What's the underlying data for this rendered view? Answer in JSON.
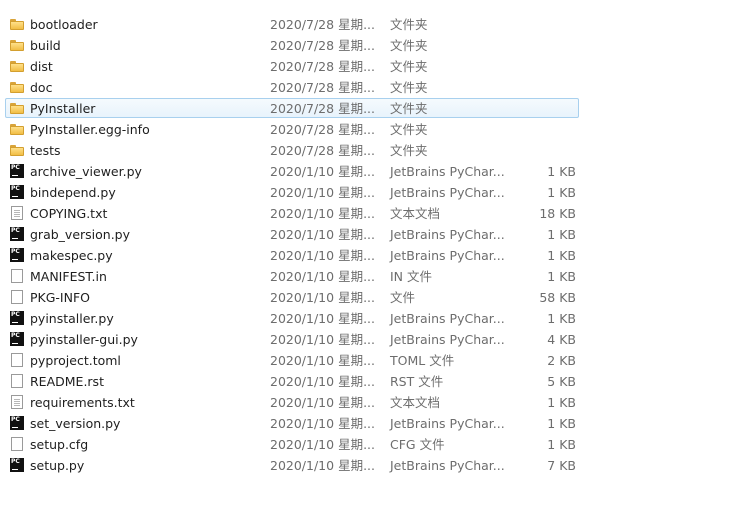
{
  "files": [
    {
      "name": "bootloader",
      "date": "2020/7/28 星期...",
      "type": "文件夹",
      "size": "",
      "icon": "folder-icon"
    },
    {
      "name": "build",
      "date": "2020/7/28 星期...",
      "type": "文件夹",
      "size": "",
      "icon": "folder-icon"
    },
    {
      "name": "dist",
      "date": "2020/7/28 星期...",
      "type": "文件夹",
      "size": "",
      "icon": "folder-icon"
    },
    {
      "name": "doc",
      "date": "2020/7/28 星期...",
      "type": "文件夹",
      "size": "",
      "icon": "folder-icon"
    },
    {
      "name": "PyInstaller",
      "date": "2020/7/28 星期...",
      "type": "文件夹",
      "size": "",
      "icon": "folder-icon",
      "selected": true
    },
    {
      "name": "PyInstaller.egg-info",
      "date": "2020/7/28 星期...",
      "type": "文件夹",
      "size": "",
      "icon": "folder-icon"
    },
    {
      "name": "tests",
      "date": "2020/7/28 星期...",
      "type": "文件夹",
      "size": "",
      "icon": "folder-icon"
    },
    {
      "name": "archive_viewer.py",
      "date": "2020/1/10 星期...",
      "type": "JetBrains PyChar...",
      "size": "1 KB",
      "icon": "pycharm-file-icon"
    },
    {
      "name": "bindepend.py",
      "date": "2020/1/10 星期...",
      "type": "JetBrains PyChar...",
      "size": "1 KB",
      "icon": "pycharm-file-icon"
    },
    {
      "name": "COPYING.txt",
      "date": "2020/1/10 星期...",
      "type": "文本文档",
      "size": "18 KB",
      "icon": "text-document-icon"
    },
    {
      "name": "grab_version.py",
      "date": "2020/1/10 星期...",
      "type": "JetBrains PyChar...",
      "size": "1 KB",
      "icon": "pycharm-file-icon"
    },
    {
      "name": "makespec.py",
      "date": "2020/1/10 星期...",
      "type": "JetBrains PyChar...",
      "size": "1 KB",
      "icon": "pycharm-file-icon"
    },
    {
      "name": "MANIFEST.in",
      "date": "2020/1/10 星期...",
      "type": "IN 文件",
      "size": "1 KB",
      "icon": "blank-file-icon"
    },
    {
      "name": "PKG-INFO",
      "date": "2020/1/10 星期...",
      "type": "文件",
      "size": "58 KB",
      "icon": "blank-file-icon"
    },
    {
      "name": "pyinstaller.py",
      "date": "2020/1/10 星期...",
      "type": "JetBrains PyChar...",
      "size": "1 KB",
      "icon": "pycharm-file-icon"
    },
    {
      "name": "pyinstaller-gui.py",
      "date": "2020/1/10 星期...",
      "type": "JetBrains PyChar...",
      "size": "4 KB",
      "icon": "pycharm-file-icon"
    },
    {
      "name": "pyproject.toml",
      "date": "2020/1/10 星期...",
      "type": "TOML 文件",
      "size": "2 KB",
      "icon": "blank-file-icon"
    },
    {
      "name": "README.rst",
      "date": "2020/1/10 星期...",
      "type": "RST 文件",
      "size": "5 KB",
      "icon": "blank-file-icon"
    },
    {
      "name": "requirements.txt",
      "date": "2020/1/10 星期...",
      "type": "文本文档",
      "size": "1 KB",
      "icon": "text-document-icon"
    },
    {
      "name": "set_version.py",
      "date": "2020/1/10 星期...",
      "type": "JetBrains PyChar...",
      "size": "1 KB",
      "icon": "pycharm-file-icon"
    },
    {
      "name": "setup.cfg",
      "date": "2020/1/10 星期...",
      "type": "CFG 文件",
      "size": "1 KB",
      "icon": "blank-file-icon"
    },
    {
      "name": "setup.py",
      "date": "2020/1/10 星期...",
      "type": "JetBrains PyChar...",
      "size": "7 KB",
      "icon": "pycharm-file-icon"
    }
  ],
  "colors": {
    "selection_border": "#a8d0ee",
    "selection_fill": "#e8f3fc",
    "secondary_text": "#6d6d6d"
  }
}
